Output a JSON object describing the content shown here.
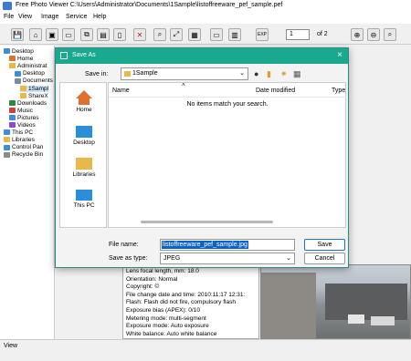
{
  "window": {
    "title": "Free Photo Viewer C:\\Users\\Administrator\\Documents\\1Sample\\listoffreeware_pef_sample.pef"
  },
  "menu": [
    "File",
    "View",
    "Image",
    "Service",
    "Help"
  ],
  "toolbar": {
    "page_value": "1",
    "page_of": "of 2",
    "zoom_label": "EXP"
  },
  "tree": {
    "items": [
      {
        "label": "Desktop",
        "color": "#3a8fd8"
      },
      {
        "label": "Home",
        "color": "#e07030"
      },
      {
        "label": "Administrat",
        "color": "#e8b84a"
      },
      {
        "label": "Desktop",
        "color": "#3a8fd8"
      },
      {
        "label": "Documents",
        "color": "#7a8aa0"
      },
      {
        "label": "1Sampl",
        "color": "#e8b84a"
      },
      {
        "label": "ShareX",
        "color": "#e8b84a"
      },
      {
        "label": "Downloads",
        "color": "#2a8a3a"
      },
      {
        "label": "Music",
        "color": "#d04040"
      },
      {
        "label": "Pictures",
        "color": "#3a8fd8"
      },
      {
        "label": "Videos",
        "color": "#8a4ad0"
      },
      {
        "label": "This PC",
        "color": "#3a8fd8"
      },
      {
        "label": "Libraries",
        "color": "#e8b84a"
      },
      {
        "label": "Control Pan",
        "color": "#3a8fd8"
      },
      {
        "label": "Recycle Bin",
        "color": "#8a8a8a"
      }
    ]
  },
  "info": [
    "Lens focal length, mm:  18.0",
    "Orientation: Normal",
    "Copyright:  ©",
    "File change date and time:  2010:11:17 12:31:",
    "Flash: Flash did not fire, compulsory flash",
    "Exposure bias (APEX):  0/10",
    "Metering mode: multi-segment",
    "Exposure mode: Auto exposure",
    "White balance: Auto white balance"
  ],
  "status": {
    "text": "View"
  },
  "dialog": {
    "title": "Save As",
    "save_in_label": "Save in:",
    "save_in_value": "1Sample",
    "places": [
      "Home",
      "Desktop",
      "Libraries",
      "This PC"
    ],
    "columns": {
      "name": "Name",
      "date": "Date modified",
      "type": "Type"
    },
    "empty_message": "No items match your search.",
    "file_name_label": "File name:",
    "file_name_value": "listoffreeware_pef_sample.jpg",
    "save_as_type_label": "Save as type:",
    "save_as_type_value": "JPEG",
    "save_button": "Save",
    "cancel_button": "Cancel"
  }
}
